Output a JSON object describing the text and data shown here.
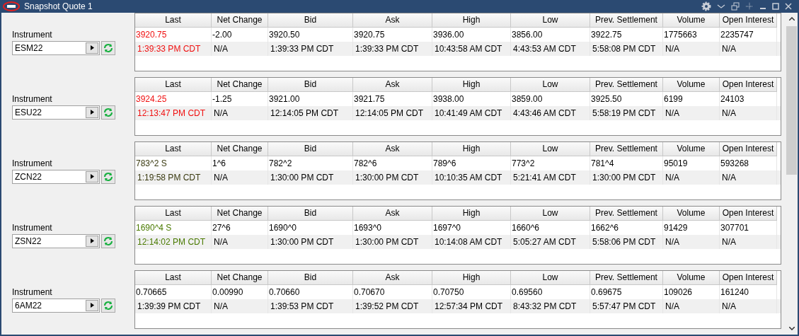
{
  "window": {
    "title": "Snapshot Quote 1"
  },
  "quotes": [
    {
      "label": "Instrument",
      "symbol": "ESM22",
      "color": "#f01010",
      "columns": [
        "Last",
        "Net Change",
        "Bid",
        "Ask",
        "High",
        "Low",
        "Prev. Settlement",
        "Volume",
        "Open Interest"
      ],
      "rows": [
        [
          "3920.75",
          "-2.00",
          "3920.50",
          "3920.75",
          "3936.00",
          "3856.00",
          "3922.75",
          "1775663",
          "2235747"
        ],
        [
          "1:39:33 PM CDT",
          "N/A",
          "1:39:33 PM CDT",
          "1:39:33 PM CDT",
          "10:43:58 AM CDT",
          "4:43:53 AM CDT",
          "5:58:08 PM CDT",
          "N/A",
          "N/A"
        ]
      ]
    },
    {
      "label": "Instrument",
      "symbol": "ESU22",
      "color": "#f01010",
      "columns": [
        "Last",
        "Net Change",
        "Bid",
        "Ask",
        "High",
        "Low",
        "Prev. Settlement",
        "Volume",
        "Open Interest"
      ],
      "rows": [
        [
          "3924.25",
          "-1.25",
          "3921.00",
          "3921.75",
          "3938.00",
          "3859.00",
          "3925.50",
          "6199",
          "24103"
        ],
        [
          "12:13:47 PM CDT",
          "N/A",
          "12:14:05 PM CDT",
          "12:14:05 PM CDT",
          "10:41:49 AM CDT",
          "4:43:46 AM CDT",
          "5:58:19 PM CDT",
          "N/A",
          "N/A"
        ]
      ]
    },
    {
      "label": "Instrument",
      "symbol": "ZCN22",
      "color": "#3a3a10",
      "columns": [
        "Last",
        "Net Change",
        "Bid",
        "Ask",
        "High",
        "Low",
        "Prev. Settlement",
        "Volume",
        "Open Interest"
      ],
      "rows": [
        [
          "783^2 S",
          "1^6",
          "782^2",
          "782^6",
          "789^6",
          "773^2",
          "781^4",
          "95019",
          "593268"
        ],
        [
          "1:19:58 PM CDT",
          "N/A",
          "1:30:00 PM CDT",
          "1:30:00 PM CDT",
          "10:10:35 AM CDT",
          "5:21:41 AM CDT",
          "1:30:00 PM CDT",
          "N/A",
          "N/A"
        ]
      ]
    },
    {
      "label": "Instrument",
      "symbol": "ZSN22",
      "color": "#4a7a00",
      "columns": [
        "Last",
        "Net Change",
        "Bid",
        "Ask",
        "High",
        "Low",
        "Prev. Settlement",
        "Volume",
        "Open Interest"
      ],
      "rows": [
        [
          "1690^4 S",
          "27^6",
          "1690^0",
          "1693^0",
          "1697^0",
          "1660^6",
          "1662^6",
          "91429",
          "307701"
        ],
        [
          "12:14:02 PM CDT",
          "N/A",
          "1:30:00 PM CDT",
          "1:30:00 PM CDT",
          "10:14:08 AM CDT",
          "5:05:27 AM CDT",
          "5:58:06 PM CDT",
          "N/A",
          "N/A"
        ]
      ]
    },
    {
      "label": "Instrument",
      "symbol": "6AM22",
      "color": "#000000",
      "columns": [
        "Last",
        "Net Change",
        "Bid",
        "Ask",
        "High",
        "Low",
        "Prev. Settlement",
        "Volume",
        "Open Interest"
      ],
      "rows": [
        [
          "0.70665",
          "0.00990",
          "0.70660",
          "0.70670",
          "0.70750",
          "0.69560",
          "0.69675",
          "109026",
          "161240"
        ],
        [
          "1:39:39 PM CDT",
          "N/A",
          "1:39:53 PM CDT",
          "1:39:52 PM CDT",
          "12:57:34 PM CDT",
          "8:43:32 PM CDT",
          "5:57:47 PM CDT",
          "N/A",
          "N/A"
        ]
      ]
    }
  ]
}
